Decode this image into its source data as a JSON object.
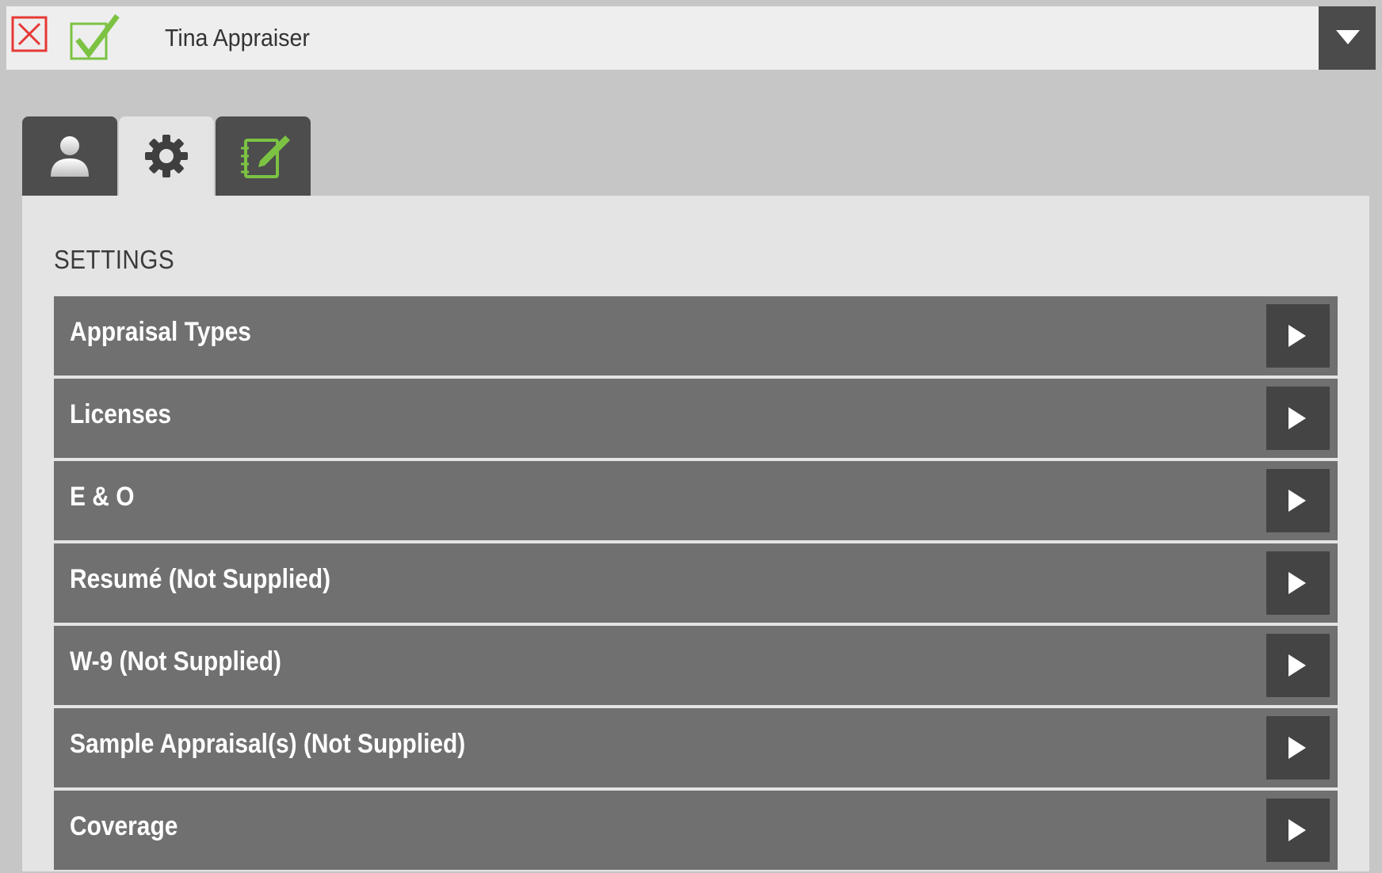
{
  "header": {
    "title": "Tina Appraiser"
  },
  "icons": {
    "close": "close-x-icon",
    "accept": "checkmark-icon",
    "dropdown": "triangle-down-icon",
    "tab_profile": "person-icon",
    "tab_settings": "gear-icon",
    "tab_notes": "notebook-edit-icon",
    "row_arrow": "triangle-right-icon"
  },
  "colors": {
    "close_red": "#e53935",
    "accept_green": "#7cc243",
    "row_bg": "#707070",
    "row_arrow_bg": "#444444"
  },
  "settings": {
    "title": "SETTINGS",
    "items": [
      {
        "label": "Appraisal Types"
      },
      {
        "label": "Licenses"
      },
      {
        "label": "E & O"
      },
      {
        "label": "Resumé (Not Supplied)"
      },
      {
        "label": "W-9 (Not Supplied)"
      },
      {
        "label": "Sample Appraisal(s) (Not Supplied)"
      },
      {
        "label": "Coverage"
      }
    ]
  }
}
